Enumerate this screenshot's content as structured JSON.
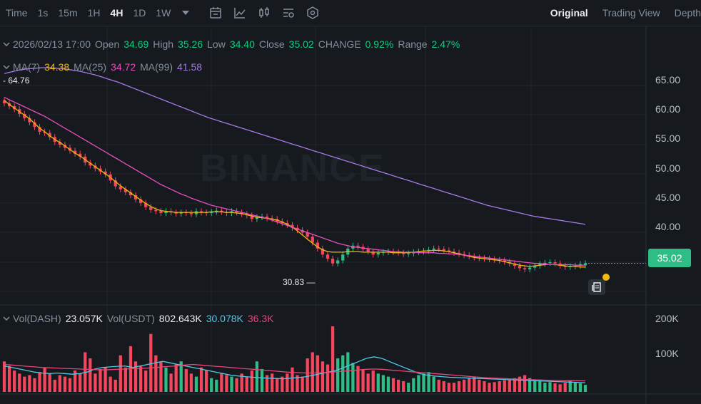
{
  "toolbar": {
    "time_label": "Time",
    "intervals": [
      "1s",
      "15m",
      "1H",
      "4H",
      "1D",
      "1W"
    ],
    "active_interval": "4H",
    "views": [
      "Original",
      "Trading View",
      "Depth"
    ],
    "active_view": "Original"
  },
  "ohlc": {
    "datetime": "2026/02/13 17:00",
    "open_label": "Open",
    "open": "34.69",
    "high_label": "High",
    "high": "35.26",
    "low_label": "Low",
    "low": "34.40",
    "close_label": "Close",
    "close": "35.02",
    "change_label": "CHANGE",
    "change": "0.92%",
    "range_label": "Range",
    "range": "2.47%"
  },
  "ma": {
    "ma7_label": "MA(7)",
    "ma7": "34.38",
    "ma25_label": "MA(25)",
    "ma25": "34.72",
    "ma99_label": "MA(99)",
    "ma99": "41.58"
  },
  "volume": {
    "dash_label": "Vol(DASH)",
    "dash": "23.057K",
    "usdt_label": "Vol(USDT)",
    "usdt": "802.643K",
    "ma1": "30.078K",
    "ma2": "36.3K"
  },
  "price_axis": [
    "65.00",
    "60.00",
    "55.00",
    "50.00",
    "45.00",
    "40.00"
  ],
  "volume_axis": [
    "200K",
    "100K"
  ],
  "current_price": "35.02",
  "high_marker": "64.76",
  "low_marker": "30.83",
  "watermark": "BINANCE",
  "colors": {
    "up": "#2ebd85",
    "down": "#f6465d",
    "ma7": "#f0b90b",
    "ma25": "#e84ec0",
    "ma99": "#a779e9",
    "vol_ma1": "#4ec9e6",
    "vol_ma2": "#e8457a",
    "background": "#161a1e"
  },
  "chart_data": {
    "type": "candlestick",
    "price_range": [
      28,
      68
    ],
    "volume_range": [
      0,
      215000
    ],
    "closes": [
      62.0,
      61.5,
      61.0,
      60.2,
      59.5,
      58.8,
      58.0,
      57.2,
      57.0,
      56.3,
      55.5,
      55.0,
      54.5,
      54.0,
      53.5,
      53.0,
      52.0,
      51.5,
      51.0,
      50.5,
      50.0,
      49.0,
      48.0,
      47.5,
      47.0,
      46.5,
      45.8,
      45.2,
      44.5,
      44.0,
      43.8,
      43.5,
      43.8,
      43.6,
      43.4,
      43.6,
      43.5,
      43.3,
      43.8,
      43.6,
      43.5,
      43.7,
      43.9,
      43.7,
      43.5,
      43.8,
      43.6,
      43.3,
      43.1,
      42.5,
      42.8,
      42.9,
      42.6,
      42.5,
      42.1,
      41.8,
      41.5,
      41.0,
      40.6,
      40.2,
      39.5,
      38.5,
      37.5,
      36.5,
      35.8,
      35.0,
      35.5,
      36.5,
      37.5,
      38.0,
      37.8,
      37.4,
      37.0,
      36.5,
      36.8,
      36.9,
      37.0,
      36.9,
      36.8,
      36.6,
      36.7,
      36.9,
      37.0,
      37.1,
      37.3,
      37.5,
      37.4,
      37.2,
      37.0,
      36.8,
      36.6,
      36.4,
      36.2,
      36.0,
      35.9,
      35.8,
      35.7,
      35.6,
      35.5,
      35.3,
      35.0,
      34.6,
      34.2,
      34.0,
      34.3,
      34.6,
      34.9,
      35.1,
      35.2,
      35.0,
      34.6,
      34.4,
      34.5,
      34.6,
      34.9,
      35.02
    ],
    "volumes": [
      100000,
      85000,
      70000,
      60000,
      50000,
      55000,
      45000,
      65000,
      80000,
      60000,
      40000,
      55000,
      50000,
      45000,
      70000,
      60000,
      130000,
      110000,
      60000,
      75000,
      80000,
      50000,
      40000,
      120000,
      80000,
      150000,
      100000,
      85000,
      70000,
      190000,
      120000,
      100000,
      80000,
      60000,
      90000,
      100000,
      75000,
      60000,
      50000,
      80000,
      70000,
      45000,
      40000,
      60000,
      55000,
      50000,
      45000,
      60000,
      50000,
      70000,
      100000,
      75000,
      55000,
      60000,
      45000,
      50000,
      60000,
      80000,
      55000,
      50000,
      110000,
      130000,
      120000,
      100000,
      90000,
      215000,
      110000,
      120000,
      130000,
      95000,
      85000,
      75000,
      60000,
      70000,
      60000,
      55000,
      50000,
      45000,
      40000,
      35000,
      30000,
      45000,
      55000,
      60000,
      65000,
      50000,
      40000,
      35000,
      30000,
      30000,
      35000,
      40000,
      45000,
      50000,
      40000,
      35000,
      30000,
      32000,
      35000,
      38000,
      40000,
      45000,
      50000,
      55000,
      45000,
      40000,
      35000,
      30000,
      32000,
      28000,
      25000,
      30000,
      35000,
      30000,
      28000,
      23057
    ],
    "ma7": [
      62.5,
      61.8,
      61.2,
      60.6,
      60.0,
      59.4,
      58.6,
      57.8,
      57.2,
      56.5,
      55.9,
      55.4,
      54.8,
      54.2,
      53.6,
      53.1,
      52.5,
      51.9,
      51.3,
      50.7,
      50.1,
      49.5,
      48.8,
      48.1,
      47.5,
      46.9,
      46.3,
      45.7,
      45.1,
      44.6,
      44.2,
      43.9,
      43.8,
      43.7,
      43.6,
      43.6,
      43.6,
      43.6,
      43.6,
      43.6,
      43.6,
      43.7,
      43.7,
      43.7,
      43.6,
      43.6,
      43.5,
      43.4,
      43.2,
      43.0,
      42.8,
      42.7,
      42.6,
      42.5,
      42.3,
      42.0,
      41.6,
      41.1,
      40.5,
      39.8,
      39.1,
      38.4,
      37.8,
      37.3,
      37.0,
      36.9,
      36.9,
      36.9,
      37.0,
      37.0,
      37.0,
      36.9,
      36.9,
      36.9,
      36.9,
      36.9,
      36.9,
      36.8,
      36.8,
      36.8,
      36.8,
      36.9,
      37.0,
      37.1,
      37.1,
      37.2,
      37.2,
      37.1,
      37.0,
      36.8,
      36.6,
      36.4,
      36.2,
      36.0,
      35.9,
      35.8,
      35.7,
      35.6,
      35.5,
      35.3,
      35.1,
      34.9,
      34.7,
      34.6,
      34.5,
      34.6,
      34.7,
      34.8,
      34.9,
      34.8,
      34.7,
      34.6,
      34.5,
      34.5,
      34.4,
      34.38
    ],
    "ma25": [
      63.0,
      62.6,
      62.2,
      61.8,
      61.4,
      61.0,
      60.6,
      60.2,
      59.8,
      59.3,
      58.8,
      58.3,
      57.8,
      57.3,
      56.8,
      56.3,
      55.8,
      55.3,
      54.8,
      54.3,
      53.8,
      53.3,
      52.8,
      52.3,
      51.8,
      51.3,
      50.8,
      50.3,
      49.8,
      49.3,
      48.8,
      48.3,
      47.9,
      47.5,
      47.1,
      46.7,
      46.4,
      46.0,
      45.7,
      45.4,
      45.1,
      44.8,
      44.6,
      44.4,
      44.2,
      44.0,
      43.8,
      43.6,
      43.4,
      43.2,
      43.0,
      42.8,
      42.6,
      42.3,
      42.0,
      41.7,
      41.4,
      41.1,
      40.8,
      40.5,
      40.2,
      39.9,
      39.6,
      39.3,
      39.0,
      38.7,
      38.4,
      38.2,
      38.0,
      37.8,
      37.7,
      37.6,
      37.5,
      37.4,
      37.3,
      37.2,
      37.1,
      37.0,
      37.0,
      36.9,
      36.9,
      36.9,
      36.8,
      36.8,
      36.8,
      36.8,
      36.7,
      36.7,
      36.6,
      36.6,
      36.5,
      36.4,
      36.3,
      36.2,
      36.1,
      36.0,
      35.9,
      35.8,
      35.7,
      35.6,
      35.5,
      35.4,
      35.3,
      35.2,
      35.1,
      35.0,
      35.0,
      34.9,
      34.9,
      34.8,
      34.8,
      34.8,
      34.8,
      34.7,
      34.7,
      34.72
    ],
    "ma99": [
      67.0,
      67.3,
      67.6,
      67.8,
      67.9,
      68.0,
      68.0,
      67.9,
      67.8,
      67.6,
      67.4,
      67.1,
      66.8,
      66.4,
      66.0,
      65.6,
      65.1,
      64.6,
      64.1,
      63.6,
      63.1,
      62.6,
      62.1,
      61.6,
      61.1,
      60.6,
      60.1,
      59.6,
      59.2,
      58.8,
      58.4,
      58.0,
      57.6,
      57.2,
      56.8,
      56.4,
      56.0,
      55.6,
      55.2,
      54.8,
      54.4,
      54.0,
      53.6,
      53.2,
      52.8,
      52.4,
      52.0,
      51.6,
      51.2,
      50.8,
      50.4,
      50.0,
      49.6,
      49.2,
      48.8,
      48.4,
      48.0,
      47.6,
      47.2,
      46.8,
      46.4,
      46.0,
      45.6,
      45.2,
      44.8,
      44.5,
      44.2,
      43.9,
      43.6,
      43.3,
      43.0,
      42.8,
      42.6,
      42.4,
      42.2,
      42.0,
      41.8,
      41.58
    ],
    "vol_ma1": [
      85000,
      80000,
      75000,
      70000,
      65000,
      62000,
      60000,
      62000,
      60000,
      58000,
      60000,
      65000,
      75000,
      80000,
      82000,
      84000,
      85000,
      80000,
      85000,
      90000,
      95000,
      100000,
      95000,
      90000,
      85000,
      80000,
      75000,
      70000,
      65000,
      60000,
      55000,
      52000,
      50000,
      48000,
      46000,
      45000,
      44000,
      43000,
      45000,
      47000,
      50000,
      55000,
      60000,
      65000,
      70000,
      80000,
      90000,
      100000,
      110000,
      115000,
      110000,
      100000,
      90000,
      80000,
      70000,
      60000,
      55000,
      52000,
      50000,
      48000,
      47000,
      46000,
      45000,
      44000,
      43000,
      42000,
      41000,
      40000,
      39000,
      38000,
      37000,
      36000,
      35000,
      34000,
      33000,
      32000,
      31000,
      30078
    ],
    "vol_ma2": [
      90000,
      88000,
      86000,
      84000,
      82000,
      80000,
      79000,
      78000,
      77000,
      76000,
      75000,
      74000,
      73000,
      72000,
      73000,
      74000,
      75000,
      76000,
      77000,
      78000,
      80000,
      82000,
      84000,
      86000,
      88000,
      90000,
      88000,
      86000,
      84000,
      82000,
      80000,
      78000,
      76000,
      74000,
      72000,
      70000,
      68000,
      66000,
      64000,
      63000,
      62000,
      62000,
      63000,
      64000,
      66000,
      68000,
      70000,
      72000,
      74000,
      75000,
      74000,
      72000,
      70000,
      68000,
      66000,
      64000,
      62000,
      60000,
      58000,
      56000,
      54000,
      52000,
      50000,
      48000,
      46000,
      45000,
      44000,
      43000,
      42000,
      41000,
      40000,
      39000,
      38000,
      37500,
      37000,
      36800,
      36500,
      36300
    ]
  }
}
